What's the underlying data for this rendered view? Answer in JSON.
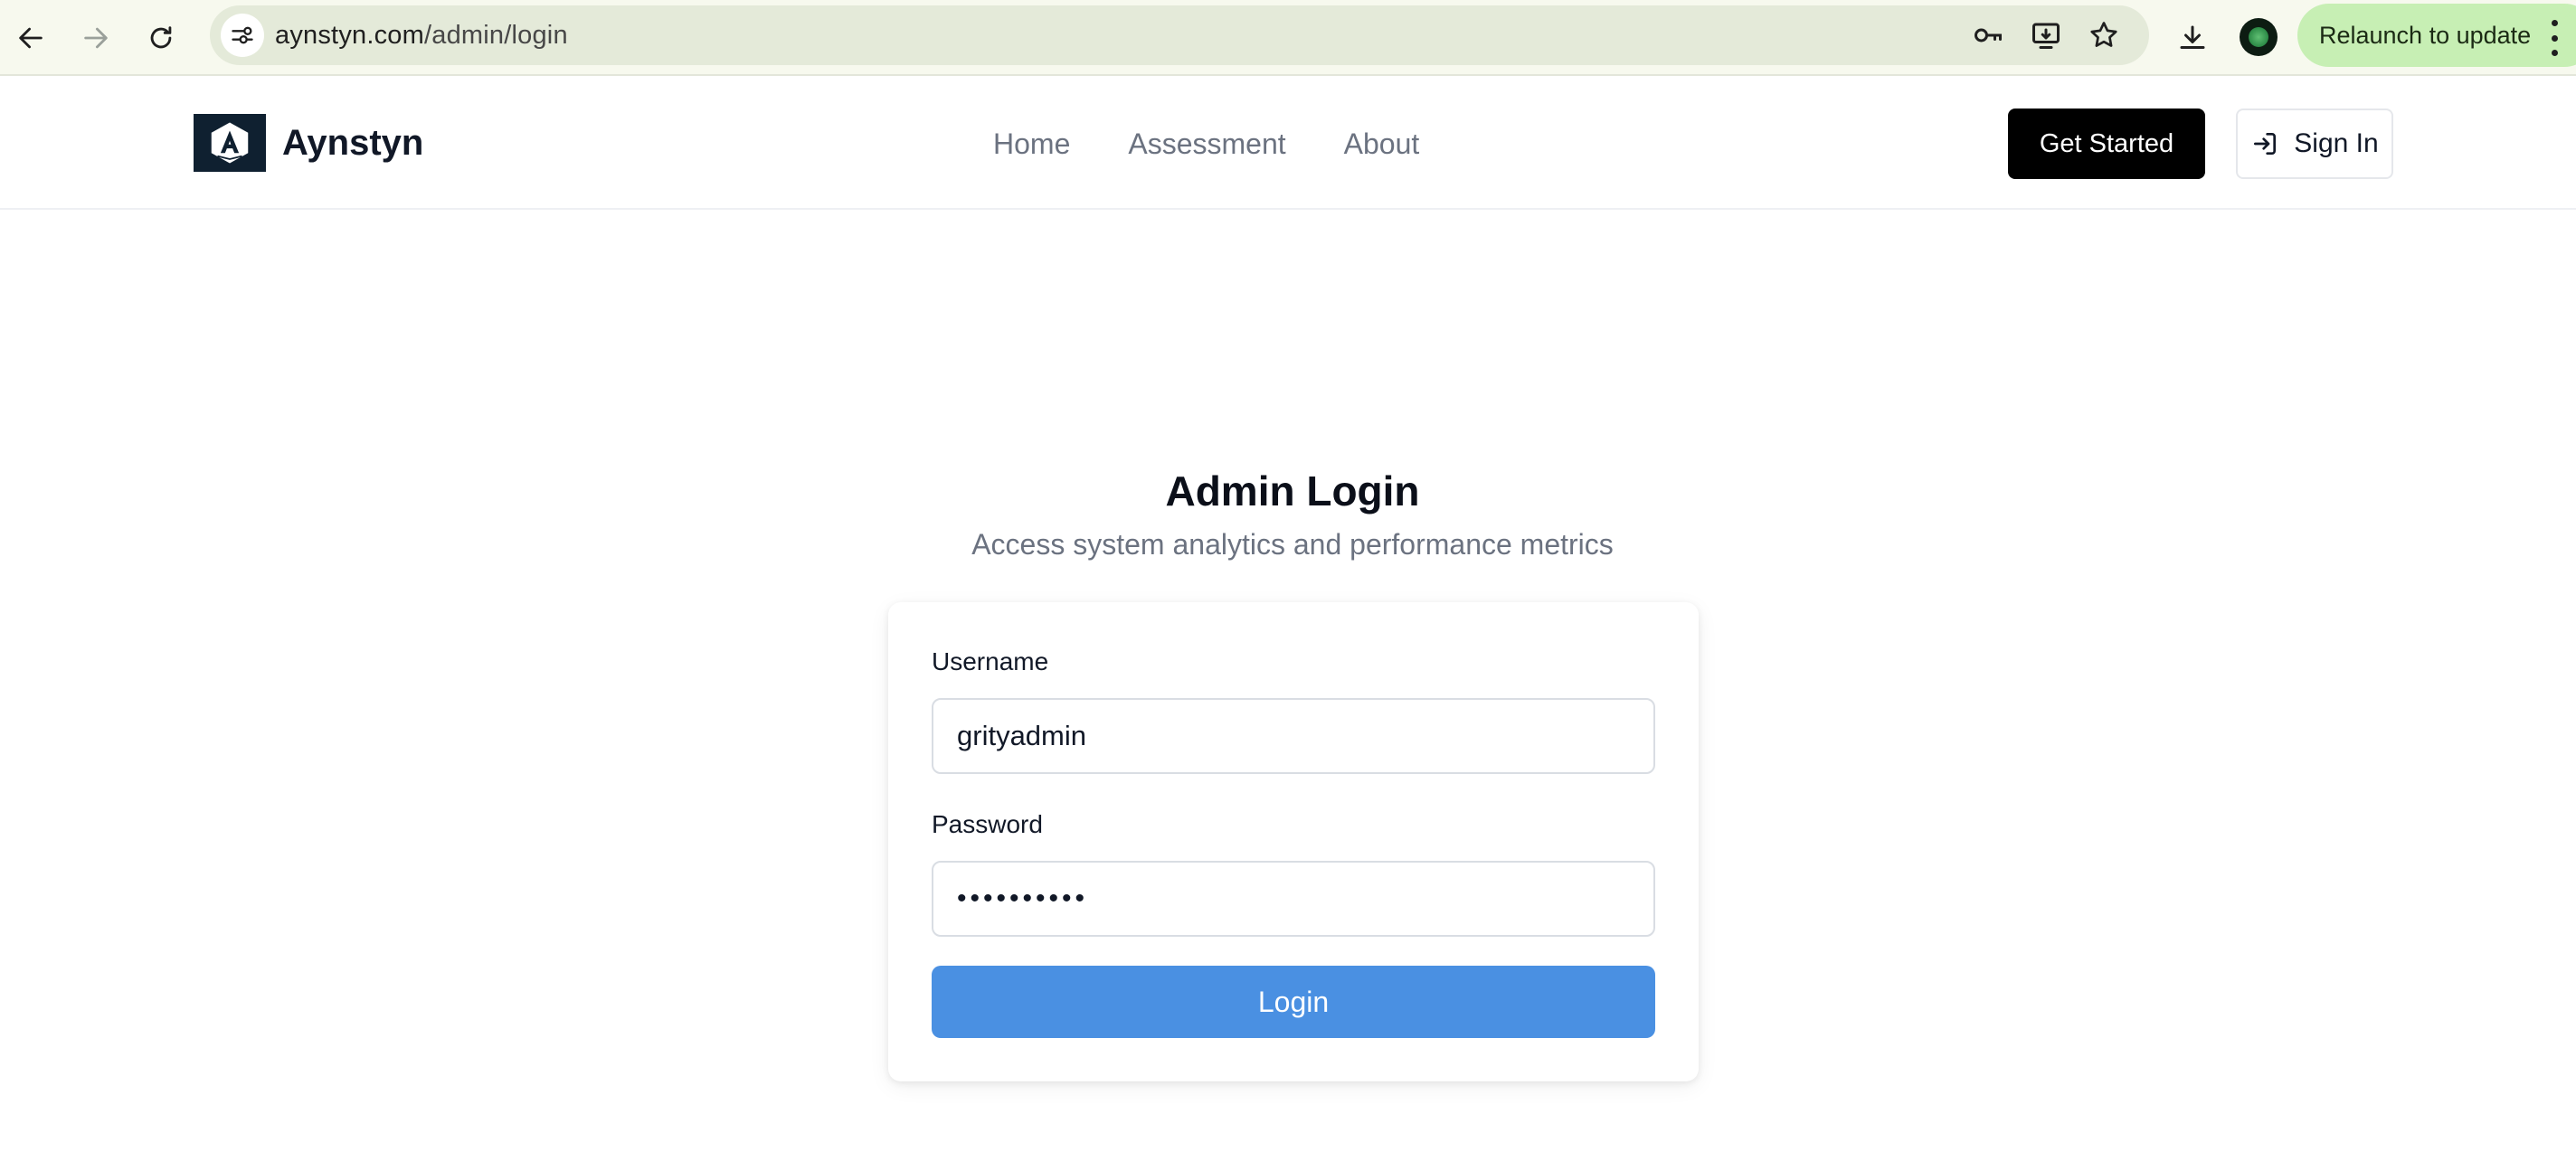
{
  "browser": {
    "url_host": "aynstyn.com",
    "url_path": "/admin/login",
    "relaunch_label": "Relaunch to update"
  },
  "header": {
    "brand_name": "Aynstyn",
    "nav": [
      "Home",
      "Assessment",
      "About"
    ],
    "get_started_label": "Get Started",
    "sign_in_label": "Sign In"
  },
  "login": {
    "title": "Admin Login",
    "subtitle": "Access system analytics and performance metrics",
    "username_label": "Username",
    "username_value": "grityadmin",
    "password_label": "Password",
    "password_value": "••••••••••",
    "login_label": "Login"
  },
  "colors": {
    "primary_button": "#4a90e2",
    "relaunch_bg": "#c7efb4",
    "logo_bg": "#0f2030"
  },
  "icons": [
    "back-arrow-icon",
    "forward-arrow-icon",
    "reload-icon",
    "site-info-icon",
    "key-icon",
    "install-app-icon",
    "bookmark-star-icon",
    "download-icon",
    "profile-avatar-icon",
    "more-menu-icon",
    "sign-in-icon"
  ]
}
